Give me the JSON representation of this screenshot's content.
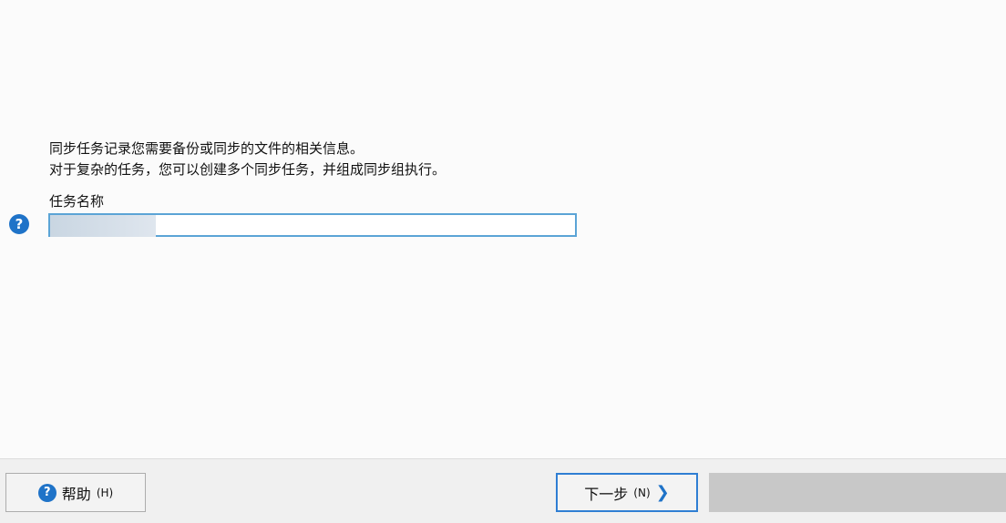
{
  "main": {
    "description_lines": [
      "同步任务记录您需要备份或同步的文件的相关信息。",
      "对于复杂的任务，您可以创建多个同步任务，并组成同步组执行。"
    ],
    "task_name_label": "任务名称",
    "task_name_value": ""
  },
  "footer": {
    "help_label": "帮助",
    "help_shortcut": "(H)",
    "next_label": "下一步",
    "next_shortcut": "(N)"
  },
  "icons": {
    "help": "question-mark-circle",
    "next": "chevron-right"
  },
  "colors": {
    "accent": "#1f73c8",
    "input_border": "#5ba4d6"
  }
}
